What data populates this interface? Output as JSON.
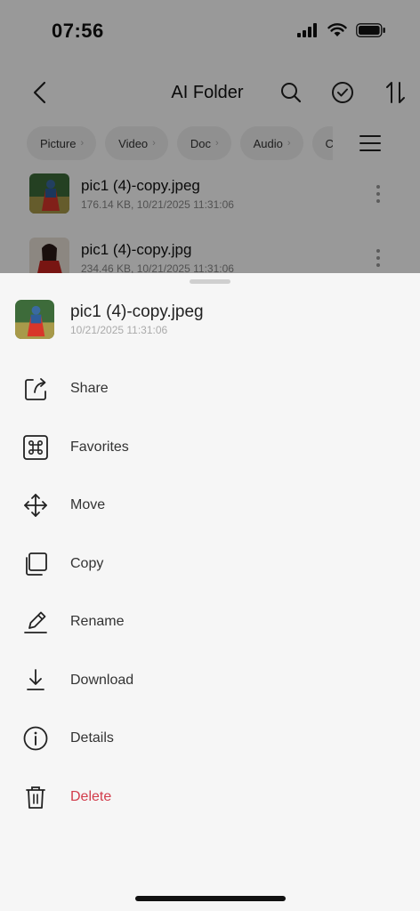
{
  "status": {
    "time": "07:56"
  },
  "nav": {
    "title": "AI Folder"
  },
  "chips": [
    "Picture",
    "Video",
    "Doc",
    "Audio",
    "C"
  ],
  "files": [
    {
      "name": "pic1 (4)-copy.jpeg",
      "meta": "176.14 KB, 10/21/2025 11:31:06"
    },
    {
      "name": "pic1 (4)-copy.jpg",
      "meta": "234.46 KB, 10/21/2025 11:31:06"
    }
  ],
  "sheet": {
    "file_name": "pic1 (4)-copy.jpeg",
    "file_meta": "10/21/2025 11:31:06",
    "actions": [
      {
        "label": "Share",
        "icon": "share-icon"
      },
      {
        "label": "Favorites",
        "icon": "command-icon"
      },
      {
        "label": "Move",
        "icon": "move-icon"
      },
      {
        "label": "Copy",
        "icon": "copy-icon"
      },
      {
        "label": "Rename",
        "icon": "pencil-icon"
      },
      {
        "label": "Download",
        "icon": "download-icon"
      },
      {
        "label": "Details",
        "icon": "info-icon"
      },
      {
        "label": "Delete",
        "icon": "trash-icon"
      }
    ]
  },
  "colors": {
    "danger": "#d23c4b",
    "overlay": "rgba(0,0,0,0.40)"
  }
}
